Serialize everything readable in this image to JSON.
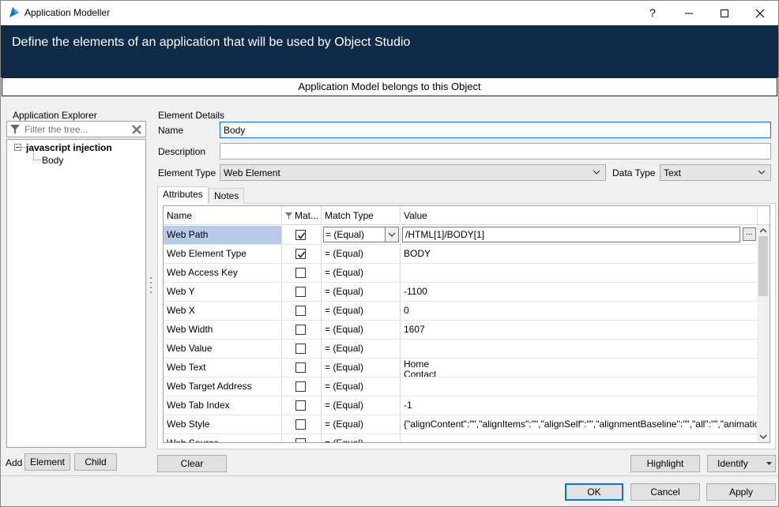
{
  "window": {
    "title": "Application Modeller",
    "help_label": "?",
    "minimize_label": "—",
    "maximize_label": "☐",
    "close_label": "✕"
  },
  "banner": {
    "text": "Define the elements of an application that will be used by Object Studio"
  },
  "belongs": {
    "text": "Application Model belongs to this Object"
  },
  "explorer": {
    "title": "Application Explorer",
    "filter_placeholder": "Filter the tree...",
    "root": "javascript injection",
    "child": "Body",
    "add_label": "Add",
    "element_button": "Element",
    "child_button": "Child"
  },
  "details": {
    "title": "Element Details",
    "name_label": "Name",
    "name_value": "Body",
    "description_label": "Description",
    "description_value": "",
    "element_type_label": "Element Type",
    "element_type_value": "Web Element",
    "data_type_label": "Data Type",
    "data_type_value": "Text"
  },
  "tabs": {
    "attributes": "Attributes",
    "notes": "Notes"
  },
  "grid": {
    "headers": {
      "name": "Name",
      "match": "Mat...",
      "match_type": "Match Type",
      "value": "Value"
    },
    "rows": [
      {
        "name": "Web Path",
        "checked": true,
        "match_type": "=  (Equal)",
        "value": "/HTML[1]/BODY[1]"
      },
      {
        "name": "Web Element Type",
        "checked": true,
        "match_type": "=  (Equal)",
        "value": "BODY"
      },
      {
        "name": "Web Access Key",
        "checked": false,
        "match_type": "=  (Equal)",
        "value": ""
      },
      {
        "name": "Web Y",
        "checked": false,
        "match_type": "=  (Equal)",
        "value": "-1100"
      },
      {
        "name": "Web X",
        "checked": false,
        "match_type": "=  (Equal)",
        "value": "0"
      },
      {
        "name": "Web Width",
        "checked": false,
        "match_type": "=  (Equal)",
        "value": "1607"
      },
      {
        "name": "Web Value",
        "checked": false,
        "match_type": "=  (Equal)",
        "value": ""
      },
      {
        "name": "Web Text",
        "checked": false,
        "match_type": "=  (Equal)",
        "value": "Home\nContact"
      },
      {
        "name": "Web Target Address",
        "checked": false,
        "match_type": "=  (Equal)",
        "value": ""
      },
      {
        "name": "Web Tab Index",
        "checked": false,
        "match_type": "=  (Equal)",
        "value": "-1"
      },
      {
        "name": "Web Style",
        "checked": false,
        "match_type": "=  (Equal)",
        "value": "{\"alignContent\":\"\",\"alignItems\":\"\",\"alignSelf\":\"\",\"alignmentBaseline\":\"\",\"all\":\"\",\"animation\"..."
      },
      {
        "name": "Web Source",
        "checked": false,
        "match_type": "=  (Equal)",
        "value": ""
      }
    ]
  },
  "buttons": {
    "clear": "Clear",
    "highlight": "Highlight",
    "identify": "Identify",
    "ok": "OK",
    "cancel": "Cancel",
    "apply": "Apply"
  },
  "colors": {
    "banner": "#0f2b47",
    "selection": "#b7cbe8",
    "focus": "#0078d7"
  }
}
